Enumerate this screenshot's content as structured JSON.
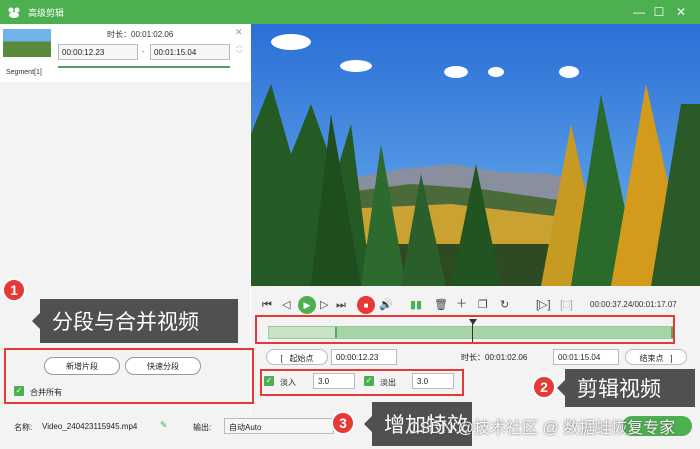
{
  "window": {
    "title": "高级剪辑"
  },
  "segment": {
    "duration_label": "时长：",
    "duration": "00:01:02.06",
    "start": "00:00:12.23",
    "end": "00:01:15.04",
    "name": "Segment[1]"
  },
  "left_buttons": {
    "new_segment": "新增片段",
    "quick_split": "快速分段",
    "merge_all": "合并所有"
  },
  "controls": {
    "time_display": "00:00:37.24/00:01:17.07"
  },
  "trim": {
    "start_point": "起始点",
    "start_time": "00:00:12.23",
    "duration_label": "时长：",
    "duration": "00:01:02.06",
    "end_time": "00:01:15.04",
    "end_point": "结束点"
  },
  "effects": {
    "fade_in_label": "淡入",
    "fade_in": "3.0",
    "fade_out_label": "淡出",
    "fade_out": "3.0"
  },
  "footer": {
    "name_label": "名称:",
    "filename": "Video_240423115945.mp4",
    "output_label": "输出:",
    "output_value": "自动Auto"
  },
  "annotations": [
    {
      "num": "1",
      "text": "分段与合并视频"
    },
    {
      "num": "2",
      "text": "剪辑视频"
    },
    {
      "num": "3",
      "text": "增加特效"
    }
  ],
  "watermark": "CSDN @技术社区 @ 数据蛙恢复专家",
  "colors": {
    "accent": "#4caf50",
    "annotation_red": "#e53935",
    "callout_bg": "#505050"
  }
}
